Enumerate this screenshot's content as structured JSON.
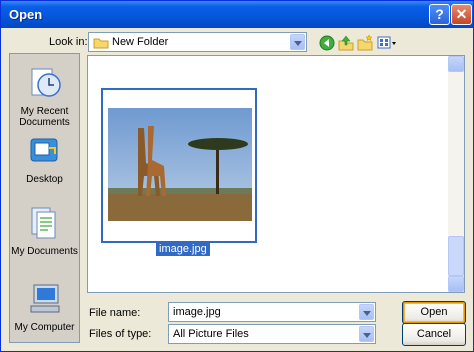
{
  "window": {
    "title": "Open"
  },
  "titlebar": {
    "help_glyph": "?",
    "close_glyph": "✕"
  },
  "look_in": {
    "label": "Look in:",
    "value": "New Folder",
    "icon": "folder-icon"
  },
  "toolbar": {
    "icons": [
      "back-icon",
      "up-folder-icon",
      "new-folder-icon",
      "views-menu-icon"
    ]
  },
  "places": [
    {
      "label": "My Recent Documents",
      "icon": "recent-documents-icon"
    },
    {
      "label": "Desktop",
      "icon": "desktop-icon"
    },
    {
      "label": "My Documents",
      "icon": "my-documents-icon"
    },
    {
      "label": "My Computer",
      "icon": "my-computer-icon"
    }
  ],
  "files": [
    {
      "name": "image.jpg",
      "selected": true
    }
  ],
  "file_name": {
    "label": "File name:",
    "value": "image.jpg"
  },
  "file_type": {
    "label": "Files of type:",
    "value": "All Picture Files"
  },
  "buttons": {
    "open": "Open",
    "cancel": "Cancel"
  },
  "colors": {
    "title_bar": "#0453d4",
    "selection": "#316ac5",
    "dialog_bg": "#ece9d8"
  }
}
